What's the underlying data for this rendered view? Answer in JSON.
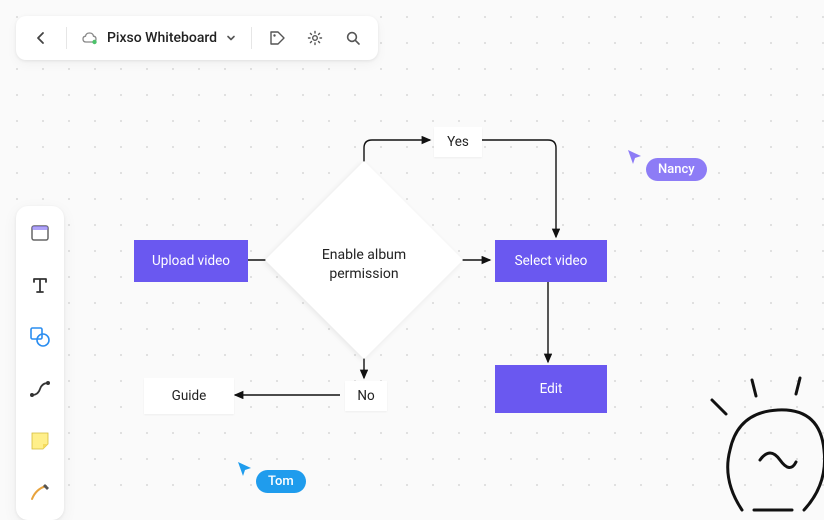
{
  "topbar": {
    "title": "Pixso Whiteboard"
  },
  "flow": {
    "upload": "Upload video",
    "enable": "Enable album permission",
    "select": "Select video",
    "edit": "Edit",
    "guide": "Guide",
    "yes": "Yes",
    "no": "No"
  },
  "cursors": {
    "nancy": "Nancy",
    "tom": "Tom"
  },
  "colors": {
    "purple": "#6a58f0",
    "nancy": "#8d7cf6",
    "tom": "#1f9ced"
  }
}
